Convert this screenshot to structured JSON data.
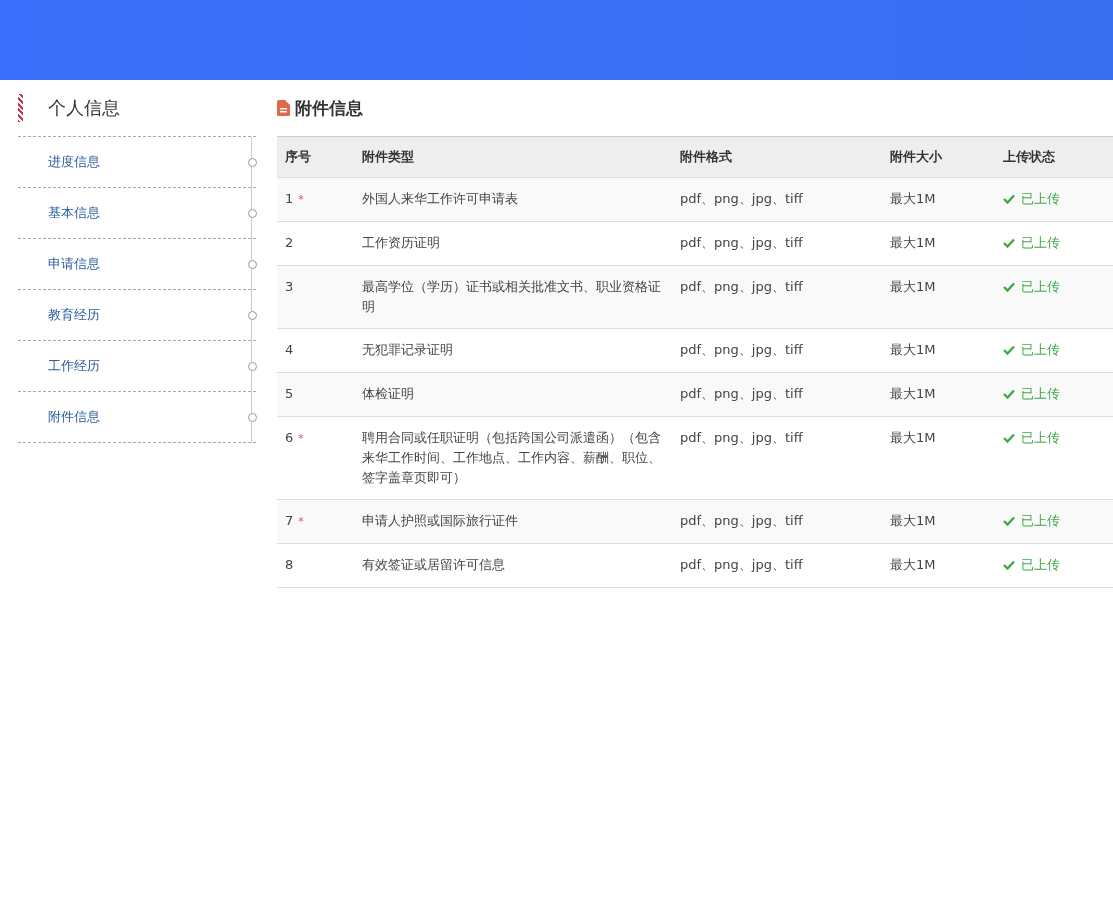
{
  "sidebar": {
    "title": "个人信息",
    "items": [
      {
        "label": "进度信息"
      },
      {
        "label": "基本信息"
      },
      {
        "label": "申请信息"
      },
      {
        "label": "教育经历"
      },
      {
        "label": "工作经历"
      },
      {
        "label": "附件信息"
      }
    ]
  },
  "section": {
    "title": "附件信息"
  },
  "table": {
    "columns": [
      "序号",
      "附件类型",
      "附件格式",
      "附件大小",
      "上传状态"
    ],
    "rows": [
      {
        "index": "1",
        "mark": "*",
        "type": "外国人来华工作许可申请表",
        "format": "pdf、png、jpg、tiff",
        "size": "最大1M",
        "status": "已上传",
        "uploaded": true
      },
      {
        "index": "2",
        "type": "工作资历证明",
        "format": "pdf、png、jpg、tiff",
        "size": "最大1M",
        "status": "已上传",
        "uploaded": true
      },
      {
        "index": "3",
        "type": "最高学位（学历）证书或相关批准文书、职业资格证明",
        "format": "pdf、png、jpg、tiff",
        "size": "最大1M",
        "status": "已上传",
        "uploaded": true
      },
      {
        "index": "4",
        "type": "无犯罪记录证明",
        "format": "pdf、png、jpg、tiff",
        "size": "最大1M",
        "status": "已上传",
        "uploaded": true
      },
      {
        "index": "5",
        "type": "体检证明",
        "format": "pdf、png、jpg、tiff",
        "size": "最大1M",
        "status": "已上传",
        "uploaded": true
      },
      {
        "index": "6",
        "mark": "*",
        "type": "聘用合同或任职证明（包括跨国公司派遣函）（包含来华工作时间、工作地点、工作内容、薪酬、职位、签字盖章页即可）",
        "format": "pdf、png、jpg、tiff",
        "size": "最大1M",
        "status": "已上传",
        "uploaded": true
      },
      {
        "index": "7",
        "mark": "*",
        "type": "申请人护照或国际旅行证件",
        "format": "pdf、png、jpg、tiff",
        "size": "最大1M",
        "status": "已上传",
        "uploaded": true
      },
      {
        "index": "8",
        "type": "有效签证或居留许可信息",
        "format": "pdf、png、jpg、tiff",
        "size": "最大1M",
        "status": "已上传",
        "uploaded": true
      }
    ]
  }
}
